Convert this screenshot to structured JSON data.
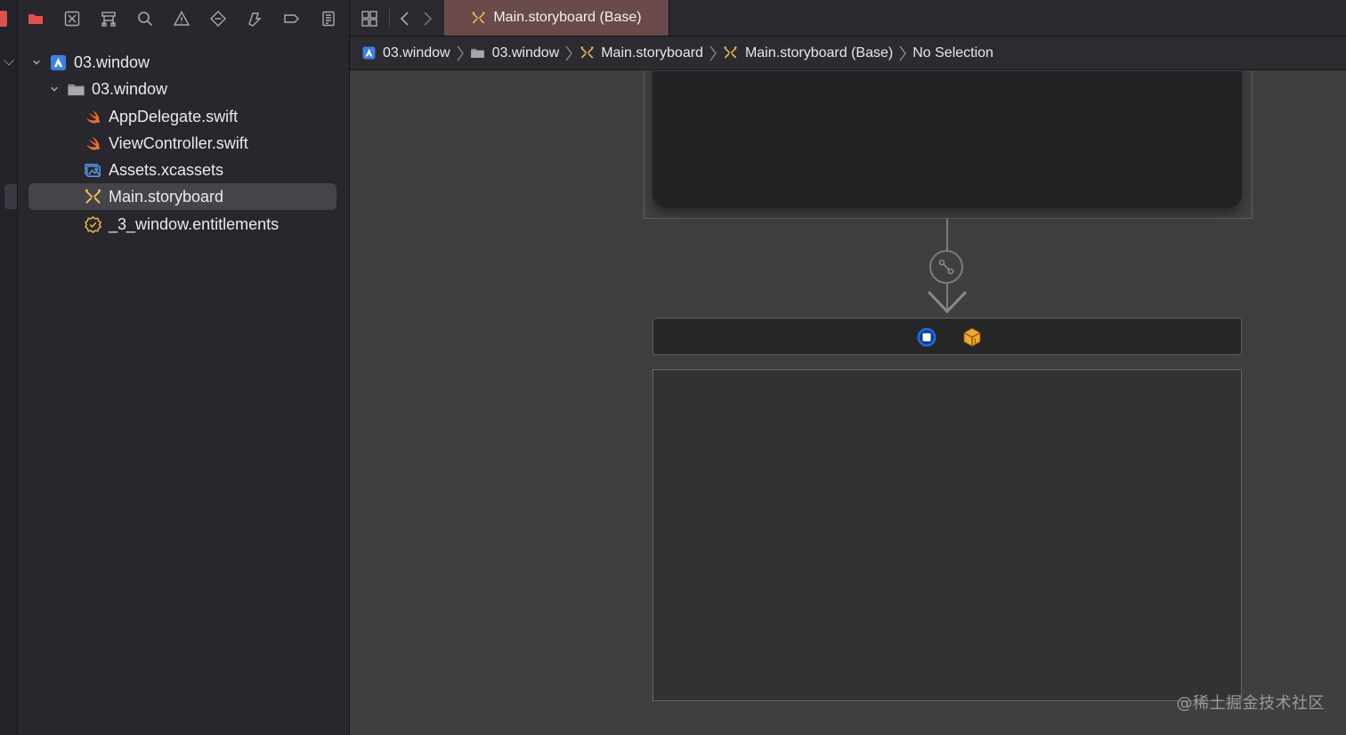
{
  "navigator": {
    "tree": [
      {
        "label": "03.window",
        "type": "project",
        "level": 0,
        "expanded": true
      },
      {
        "label": "03.window",
        "type": "folder",
        "level": 1,
        "expanded": true
      },
      {
        "label": "AppDelegate.swift",
        "type": "swift",
        "level": 2
      },
      {
        "label": "ViewController.swift",
        "type": "swift",
        "level": 2
      },
      {
        "label": "Assets.xcassets",
        "type": "assets",
        "level": 2
      },
      {
        "label": "Main.storyboard",
        "type": "storyboard",
        "level": 2,
        "selected": true
      },
      {
        "label": "_3_window.entitlements",
        "type": "entitlements",
        "level": 2
      }
    ]
  },
  "editor": {
    "tab": {
      "label": "Main.storyboard (Base)"
    },
    "jumpbar": [
      {
        "label": "03.window",
        "icon": "project-icon"
      },
      {
        "label": "03.window",
        "icon": "folder-icon"
      },
      {
        "label": "Main.storyboard",
        "icon": "storyboard-icon"
      },
      {
        "label": "Main.storyboard (Base)",
        "icon": "storyboard-icon"
      },
      {
        "label": "No Selection",
        "icon": null
      }
    ]
  },
  "watermark": "@稀土掘金技术社区",
  "colors": {
    "accent_blue": "#3d7fe6",
    "swift_orange": "#f0702a",
    "storyboard_yellow": "#f2c14e",
    "tab_active": "#6a4a4a",
    "selection": "#45444b"
  }
}
